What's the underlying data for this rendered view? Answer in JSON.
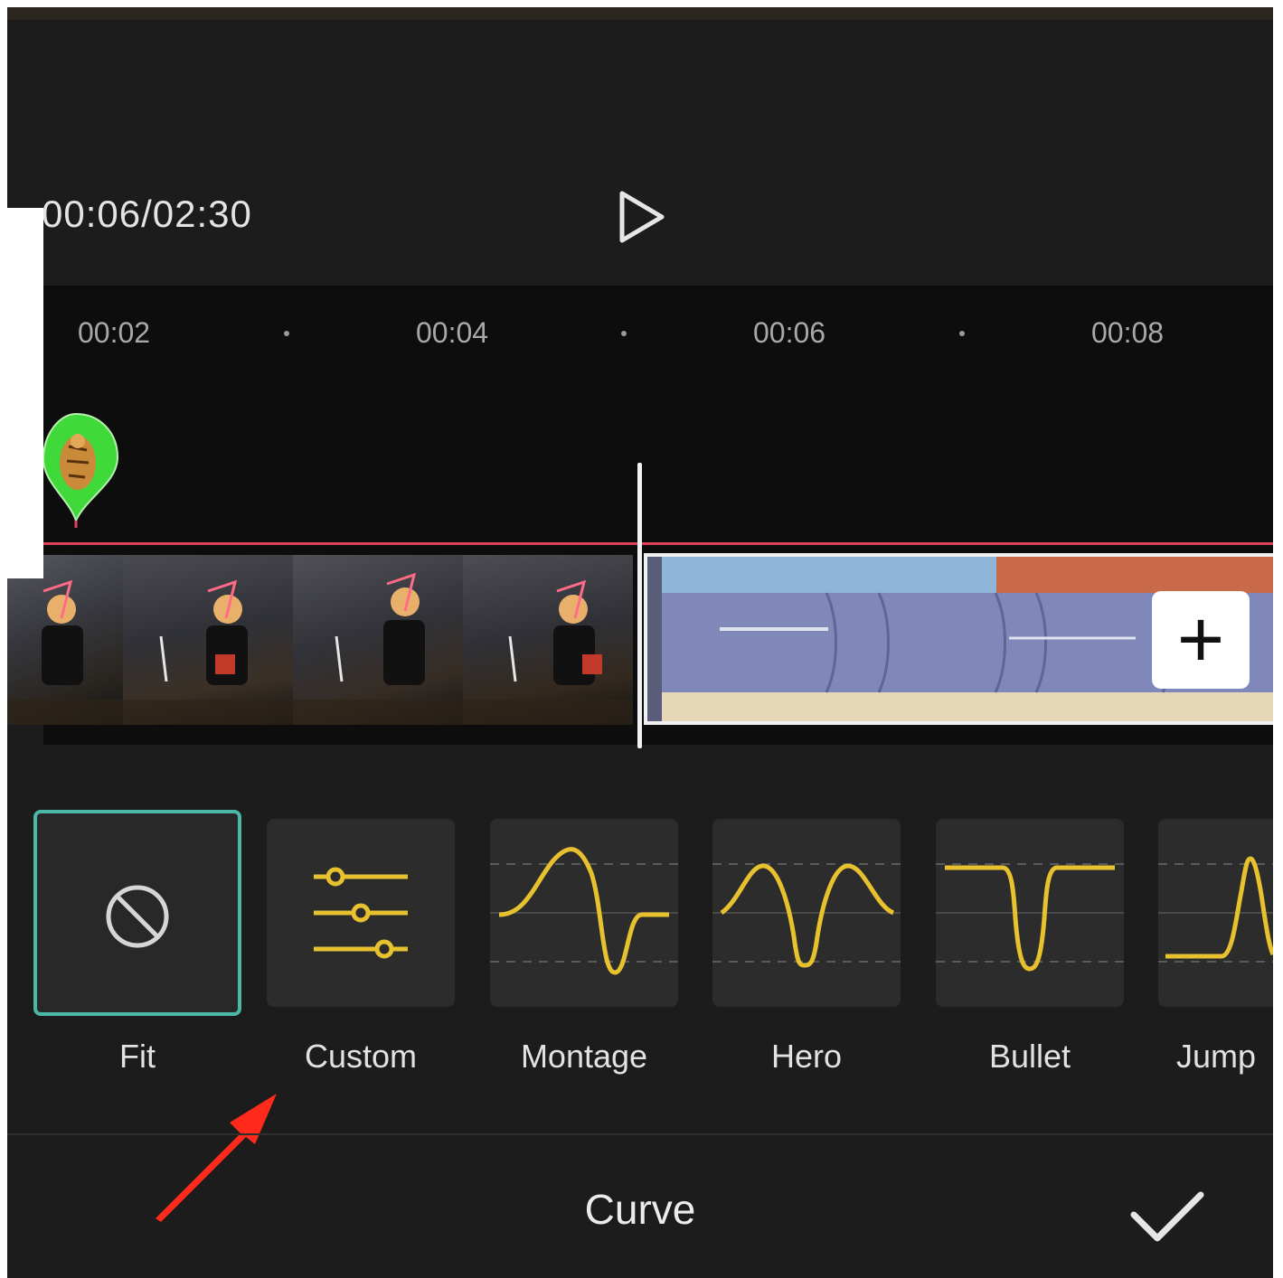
{
  "player": {
    "time_display": "00:06/02:30"
  },
  "timeline": {
    "ticks": [
      "00:02",
      "00:04",
      "00:06",
      "00:08"
    ]
  },
  "clip": {
    "add_button": "+"
  },
  "presets": [
    {
      "label": "Fit",
      "icon": "none-icon",
      "selected": true
    },
    {
      "label": "Custom",
      "icon": "sliders-icon",
      "selected": false
    },
    {
      "label": "Montage",
      "icon": "montage-curve-icon",
      "selected": false
    },
    {
      "label": "Hero",
      "icon": "hero-curve-icon",
      "selected": false
    },
    {
      "label": "Bullet",
      "icon": "bullet-curve-icon",
      "selected": false
    },
    {
      "label": "Jump",
      "icon": "jump-curve-icon",
      "selected": false
    }
  ],
  "footer": {
    "title": "Curve"
  },
  "colors": {
    "background": "#1c1c1c",
    "timeline_bg": "#0d0d0d",
    "curve": "#e8c12e",
    "selection_border": "#4bb8a8",
    "accent_line": "#e0425a",
    "annotation_arrow": "#ff2a1a"
  }
}
